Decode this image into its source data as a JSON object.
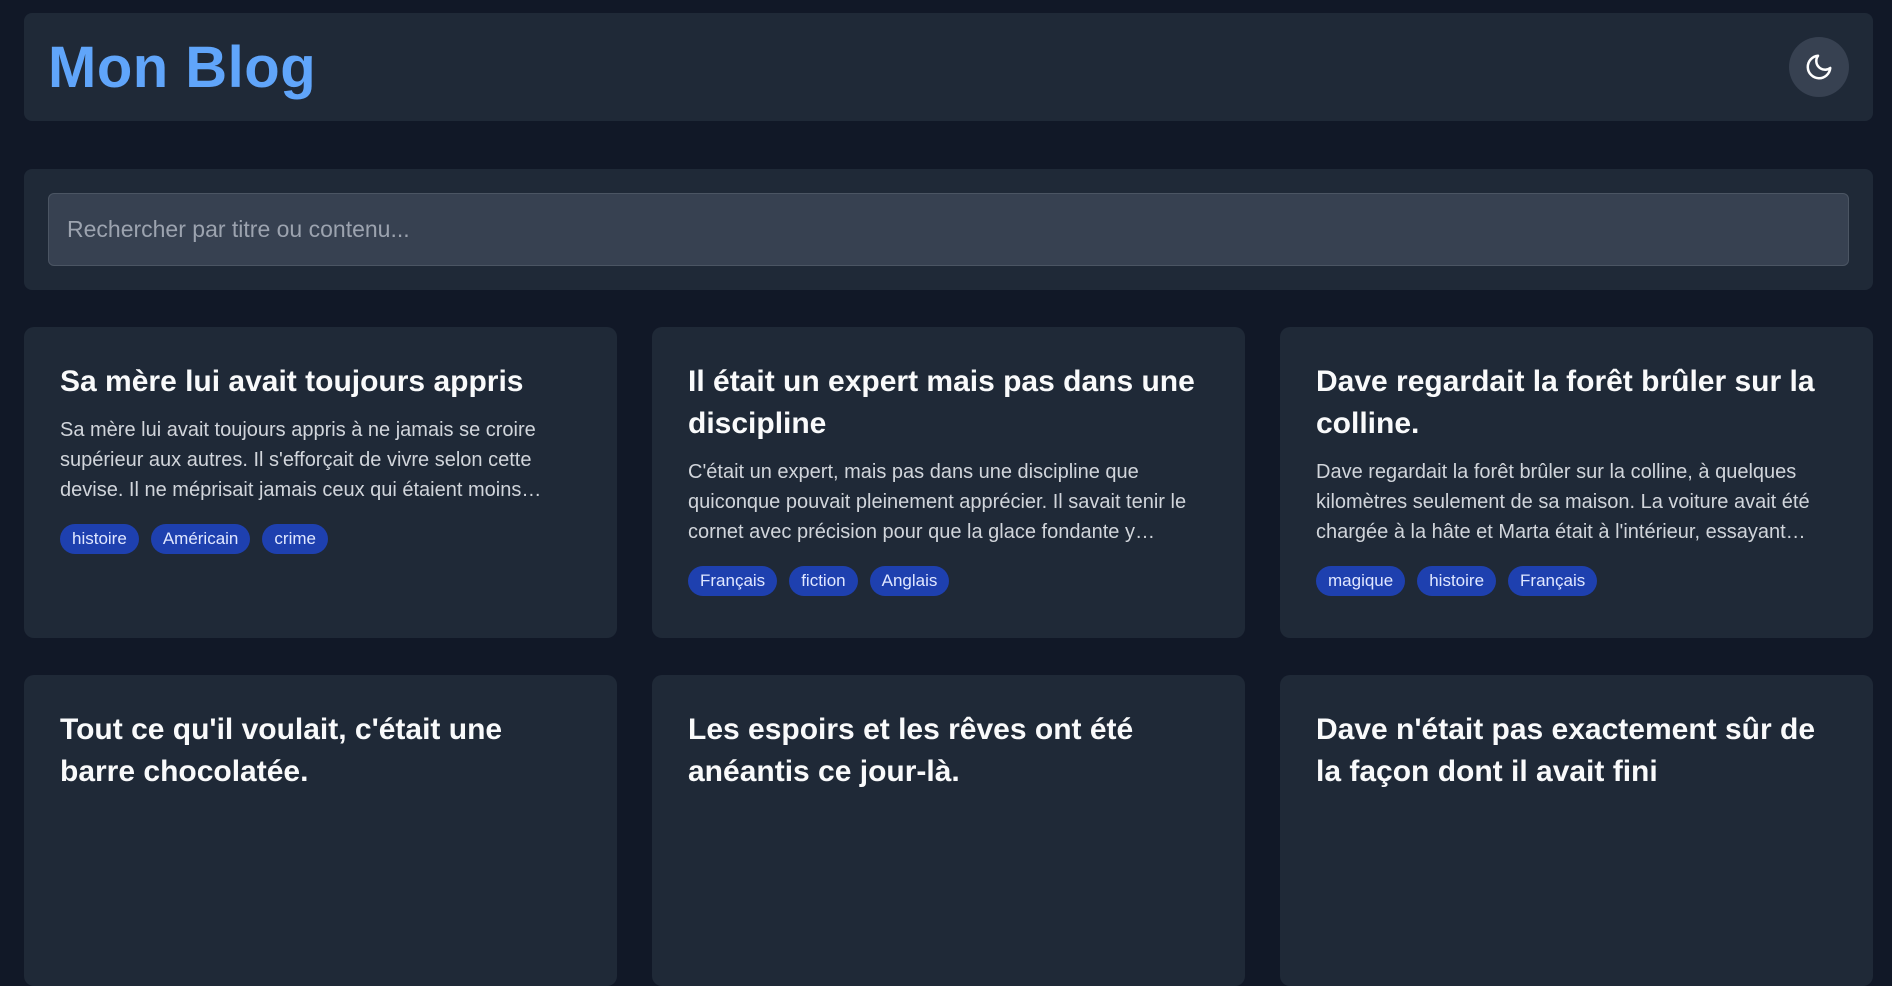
{
  "header": {
    "title": "Mon Blog",
    "theme_icon": "moon-icon"
  },
  "search": {
    "placeholder": "Rechercher par titre ou contenu..."
  },
  "colors": {
    "background": "#111827",
    "panel": "#1f2937",
    "accent": "#60a5fa",
    "tag": "#1e40af"
  },
  "posts": [
    {
      "title": "Sa mère lui avait toujours appris",
      "excerpt": "Sa mère lui avait toujours appris à ne jamais se croire supérieur aux autres. Il s'efforçait de vivre selon cette devise. Il ne méprisait jamais ceux qui étaient moins…",
      "tags": [
        "histoire",
        "Américain",
        "crime"
      ]
    },
    {
      "title": "Il était un expert mais pas dans une discipline",
      "excerpt": "C'était un expert, mais pas dans une discipline que quiconque pouvait pleinement apprécier. Il savait tenir le cornet avec précision pour que la glace fondante y…",
      "tags": [
        "Français",
        "fiction",
        "Anglais"
      ]
    },
    {
      "title": "Dave regardait la forêt brûler sur la colline.",
      "excerpt": "Dave regardait la forêt brûler sur la colline, à quelques kilomètres seulement de sa maison. La voiture avait été chargée à la hâte et Marta était à l'intérieur, essayant…",
      "tags": [
        "magique",
        "histoire",
        "Français"
      ]
    },
    {
      "title": "Tout ce qu'il voulait, c'était une barre chocolatée.",
      "excerpt": "",
      "tags": []
    },
    {
      "title": "Les espoirs et les rêves ont été anéantis ce jour-là.",
      "excerpt": "",
      "tags": []
    },
    {
      "title": "Dave n'était pas exactement sûr de la façon dont il avait fini",
      "excerpt": "",
      "tags": []
    }
  ]
}
